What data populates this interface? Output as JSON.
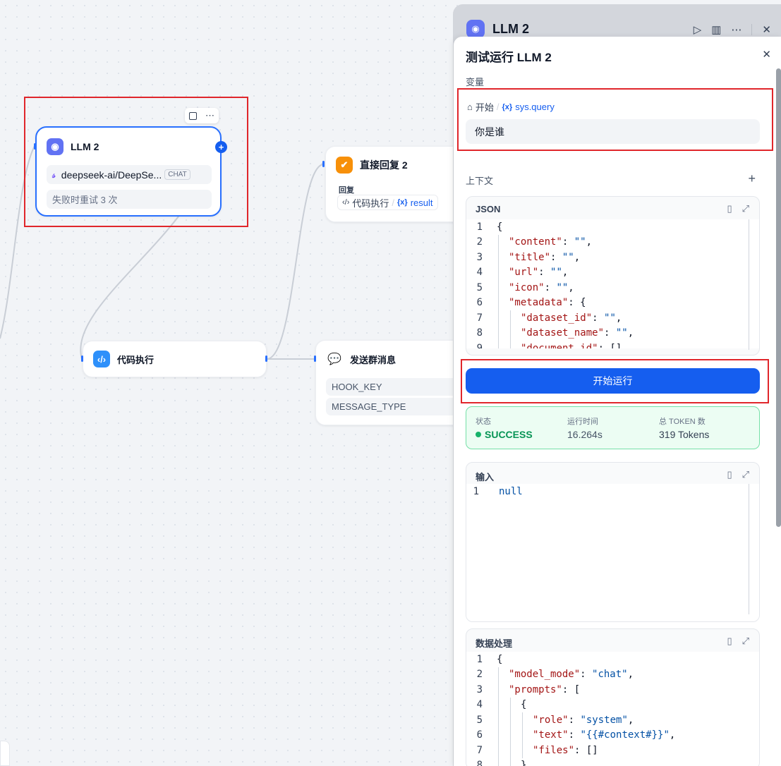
{
  "canvas": {
    "llm_node": {
      "title": "LLM 2",
      "model": "deepseek-ai/DeepSe...",
      "mode_badge": "CHAT",
      "retry": "失败时重试 3 次"
    },
    "reply_node": {
      "title": "直接回复 2",
      "field_label": "回复",
      "var_source": "代码执行",
      "var_name": "result"
    },
    "code_node": {
      "title": "代码执行"
    },
    "message_node": {
      "title": "发送群消息",
      "fields": [
        "HOOK_KEY",
        "MESSAGE_TYPE"
      ]
    }
  },
  "panel_back": {
    "title": "LLM 2"
  },
  "panel": {
    "title": "测试运行 LLM 2",
    "variables_label": "变量",
    "var_source": "开始",
    "var_name": "sys.query",
    "var_value": "你是谁",
    "context_label": "上下文",
    "json_title": "JSON",
    "run_button": "开始运行",
    "status": {
      "status_label": "状态",
      "status_value": "SUCCESS",
      "time_label": "运行时间",
      "time_value": "16.264s",
      "tokens_label": "总 TOKEN 数",
      "tokens_value": "319 Tokens"
    },
    "input_title": "输入",
    "input_line_no": "1",
    "input_value": "null",
    "process_title": "数据处理"
  },
  "json_lines": [
    {
      "n": "1",
      "indent": 0,
      "tokens": [
        [
          "p",
          "{"
        ]
      ]
    },
    {
      "n": "2",
      "indent": 1,
      "tokens": [
        [
          "k",
          "\"content\""
        ],
        [
          "p",
          ": "
        ],
        [
          "s",
          "\"\""
        ],
        [
          "p",
          ","
        ]
      ]
    },
    {
      "n": "3",
      "indent": 1,
      "tokens": [
        [
          "k",
          "\"title\""
        ],
        [
          "p",
          ": "
        ],
        [
          "s",
          "\"\""
        ],
        [
          "p",
          ","
        ]
      ]
    },
    {
      "n": "4",
      "indent": 1,
      "tokens": [
        [
          "k",
          "\"url\""
        ],
        [
          "p",
          ": "
        ],
        [
          "s",
          "\"\""
        ],
        [
          "p",
          ","
        ]
      ]
    },
    {
      "n": "5",
      "indent": 1,
      "tokens": [
        [
          "k",
          "\"icon\""
        ],
        [
          "p",
          ": "
        ],
        [
          "s",
          "\"\""
        ],
        [
          "p",
          ","
        ]
      ]
    },
    {
      "n": "6",
      "indent": 1,
      "tokens": [
        [
          "k",
          "\"metadata\""
        ],
        [
          "p",
          ": {"
        ]
      ]
    },
    {
      "n": "7",
      "indent": 2,
      "tokens": [
        [
          "k",
          "\"dataset_id\""
        ],
        [
          "p",
          ": "
        ],
        [
          "s",
          "\"\""
        ],
        [
          "p",
          ","
        ]
      ]
    },
    {
      "n": "8",
      "indent": 2,
      "tokens": [
        [
          "k",
          "\"dataset_name\""
        ],
        [
          "p",
          ": "
        ],
        [
          "s",
          "\"\""
        ],
        [
          "p",
          ","
        ]
      ]
    },
    {
      "n": "9",
      "indent": 2,
      "tokens": [
        [
          "k",
          "\"document_id\""
        ],
        [
          "p",
          ": []"
        ]
      ]
    }
  ],
  "process_lines": [
    {
      "n": "1",
      "indent": 0,
      "tokens": [
        [
          "p",
          "{"
        ]
      ]
    },
    {
      "n": "2",
      "indent": 1,
      "tokens": [
        [
          "k",
          "\"model_mode\""
        ],
        [
          "p",
          ": "
        ],
        [
          "s",
          "\"chat\""
        ],
        [
          "p",
          ","
        ]
      ]
    },
    {
      "n": "3",
      "indent": 1,
      "tokens": [
        [
          "k",
          "\"prompts\""
        ],
        [
          "p",
          ": ["
        ]
      ]
    },
    {
      "n": "4",
      "indent": 2,
      "tokens": [
        [
          "p",
          "{"
        ]
      ]
    },
    {
      "n": "5",
      "indent": 3,
      "tokens": [
        [
          "k",
          "\"role\""
        ],
        [
          "p",
          ": "
        ],
        [
          "s",
          "\"system\""
        ],
        [
          "p",
          ","
        ]
      ]
    },
    {
      "n": "6",
      "indent": 3,
      "tokens": [
        [
          "k",
          "\"text\""
        ],
        [
          "p",
          ": "
        ],
        [
          "s",
          "\"{{#context#}}\""
        ],
        [
          "p",
          ","
        ]
      ]
    },
    {
      "n": "7",
      "indent": 3,
      "tokens": [
        [
          "k",
          "\"files\""
        ],
        [
          "p",
          ": []"
        ]
      ]
    },
    {
      "n": "8",
      "indent": 2,
      "tokens": [
        [
          "p",
          "},"
        ]
      ]
    }
  ],
  "colors": {
    "primary": "#155eef",
    "success": "#17b26a",
    "highlight": "#e0262b"
  }
}
